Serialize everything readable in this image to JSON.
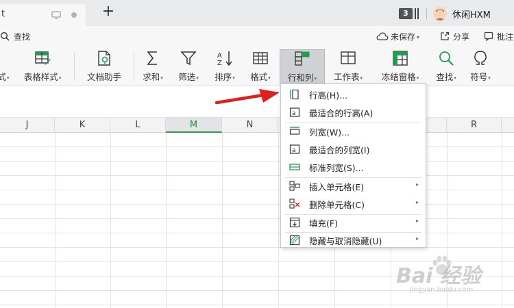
{
  "colors": {
    "accent_green": "#2e9c4b",
    "ribbon_bg": "#f7f7f8",
    "active_button": "#d0d1d4",
    "arrow_red": "#e0201b",
    "icon_green": "#1f9e52"
  },
  "titlebar": {
    "doc_tab_label": "t",
    "new_tab_label": "+",
    "window_count": "3",
    "user_name": "休闲HXM"
  },
  "quickbar": {
    "search_label": "查找",
    "save_status": "未保存",
    "share_label": "分享",
    "comment_label": "批注"
  },
  "ribbon": {
    "items": [
      {
        "label": "式",
        "icon": "style-icon"
      },
      {
        "label": "表格样式",
        "icon": "table-style-icon"
      },
      {
        "label": "文档助手",
        "icon": "doc-assistant-icon"
      },
      {
        "label": "求和",
        "icon": "sum-icon"
      },
      {
        "label": "筛选",
        "icon": "filter-icon"
      },
      {
        "label": "排序",
        "icon": "sort-icon"
      },
      {
        "label": "格式",
        "icon": "format-icon"
      },
      {
        "label": "行和列",
        "icon": "rows-columns-icon"
      },
      {
        "label": "工作表",
        "icon": "worksheet-icon"
      },
      {
        "label": "冻结窗格",
        "icon": "freeze-panes-icon"
      },
      {
        "label": "查找",
        "icon": "find-icon"
      },
      {
        "label": "符号",
        "icon": "symbol-icon"
      }
    ],
    "active": "行和列"
  },
  "grid": {
    "columns": [
      "J",
      "K",
      "L",
      "M",
      "N",
      "",
      "",
      "",
      "R"
    ],
    "selected_column": "M"
  },
  "menu": {
    "items": [
      {
        "label": "行高(H)...",
        "icon": "row-height-icon",
        "submenu": false
      },
      {
        "label": "最适合的行高(A)",
        "icon": "autofit-row-height-icon",
        "submenu": false
      },
      {
        "label": "列宽(W)...",
        "icon": "column-width-icon",
        "submenu": false
      },
      {
        "label": "最适合的列宽(I)",
        "icon": "autofit-column-width-icon",
        "submenu": false
      },
      {
        "label": "标准列宽(S)...",
        "icon": "standard-column-width-icon",
        "submenu": false
      },
      {
        "label": "插入单元格(E)",
        "icon": "insert-cells-icon",
        "submenu": true
      },
      {
        "label": "删除单元格(C)",
        "icon": "delete-cells-icon",
        "submenu": true
      },
      {
        "label": "填充(F)",
        "icon": "fill-icon",
        "submenu": true
      },
      {
        "label": "隐藏与取消隐藏(U)",
        "icon": "hide-unhide-icon",
        "submenu": true
      }
    ]
  },
  "watermark": {
    "brand": "Bai 经验",
    "url": "jingyan.baidu.com"
  }
}
